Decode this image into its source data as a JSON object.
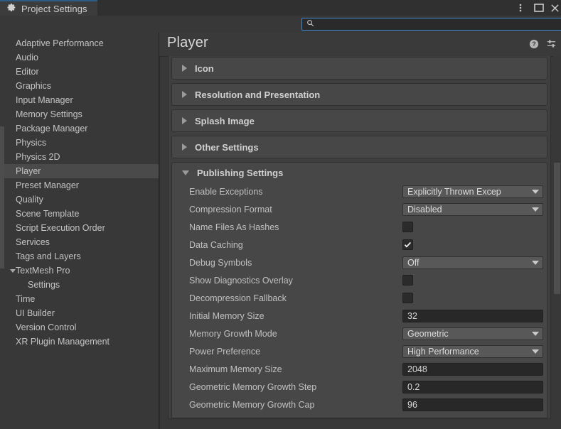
{
  "window": {
    "tab_title": "Project Settings",
    "tab_icon": "gear-icon",
    "menu_icon": "kebab-menu-icon",
    "maximize_icon": "maximize-icon",
    "close_icon": "close-icon"
  },
  "search": {
    "value": "",
    "placeholder": "",
    "icon": "search-icon"
  },
  "sidebar": {
    "items": [
      {
        "label": "Adaptive Performance",
        "selected": false,
        "child": false,
        "expander": "none"
      },
      {
        "label": "Audio",
        "selected": false,
        "child": false,
        "expander": "none"
      },
      {
        "label": "Editor",
        "selected": false,
        "child": false,
        "expander": "none"
      },
      {
        "label": "Graphics",
        "selected": false,
        "child": false,
        "expander": "none"
      },
      {
        "label": "Input Manager",
        "selected": false,
        "child": false,
        "expander": "none"
      },
      {
        "label": "Memory Settings",
        "selected": false,
        "child": false,
        "expander": "none"
      },
      {
        "label": "Package Manager",
        "selected": false,
        "child": false,
        "expander": "none"
      },
      {
        "label": "Physics",
        "selected": false,
        "child": false,
        "expander": "none"
      },
      {
        "label": "Physics 2D",
        "selected": false,
        "child": false,
        "expander": "none"
      },
      {
        "label": "Player",
        "selected": true,
        "child": false,
        "expander": "none"
      },
      {
        "label": "Preset Manager",
        "selected": false,
        "child": false,
        "expander": "none"
      },
      {
        "label": "Quality",
        "selected": false,
        "child": false,
        "expander": "none"
      },
      {
        "label": "Scene Template",
        "selected": false,
        "child": false,
        "expander": "none"
      },
      {
        "label": "Script Execution Order",
        "selected": false,
        "child": false,
        "expander": "none"
      },
      {
        "label": "Services",
        "selected": false,
        "child": false,
        "expander": "none"
      },
      {
        "label": "Tags and Layers",
        "selected": false,
        "child": false,
        "expander": "none"
      },
      {
        "label": "TextMesh Pro",
        "selected": false,
        "child": false,
        "expander": "open"
      },
      {
        "label": "Settings",
        "selected": false,
        "child": true,
        "expander": "none"
      },
      {
        "label": "Time",
        "selected": false,
        "child": false,
        "expander": "none"
      },
      {
        "label": "UI Builder",
        "selected": false,
        "child": false,
        "expander": "none"
      },
      {
        "label": "Version Control",
        "selected": false,
        "child": false,
        "expander": "none"
      },
      {
        "label": "XR Plugin Management",
        "selected": false,
        "child": false,
        "expander": "none"
      }
    ]
  },
  "inspector": {
    "title": "Player",
    "help_icon": "help-icon",
    "preset_icon": "preset-settings-icon",
    "collapsed_sections": [
      {
        "label": "Icon"
      },
      {
        "label": "Resolution and Presentation"
      },
      {
        "label": "Splash Image"
      },
      {
        "label": "Other Settings"
      }
    ],
    "open_section": {
      "label": "Publishing Settings",
      "rows": [
        {
          "label": "Enable Exceptions",
          "type": "dropdown",
          "value": "Explicitly Thrown Excep"
        },
        {
          "label": "Compression Format",
          "type": "dropdown",
          "value": "Disabled"
        },
        {
          "label": "Name Files As Hashes",
          "type": "checkbox",
          "checked": false
        },
        {
          "label": "Data Caching",
          "type": "checkbox",
          "checked": true
        },
        {
          "label": "Debug Symbols",
          "type": "dropdown",
          "value": "Off"
        },
        {
          "label": "Show Diagnostics Overlay",
          "type": "checkbox",
          "checked": false
        },
        {
          "label": "Decompression Fallback",
          "type": "checkbox",
          "checked": false
        },
        {
          "label": "Initial Memory Size",
          "type": "text",
          "value": "32"
        },
        {
          "label": "Memory Growth Mode",
          "type": "dropdown",
          "value": "Geometric"
        },
        {
          "label": "Power Preference",
          "type": "dropdown",
          "value": "High Performance"
        },
        {
          "label": "Maximum Memory Size",
          "type": "text",
          "value": "2048"
        },
        {
          "label": "Geometric Memory Growth Step",
          "type": "text",
          "value": "0.2"
        },
        {
          "label": "Geometric Memory Growth Cap",
          "type": "text",
          "value": "96"
        }
      ]
    }
  },
  "colors": {
    "background": "#383838",
    "panel": "#3f3f3f",
    "foldout": "#474747",
    "accent_blue": "#3f88d4",
    "tab_accent": "#2c5d87",
    "text": "#c4c4c4",
    "field_dark": "#282828",
    "dropdown": "#585858"
  }
}
